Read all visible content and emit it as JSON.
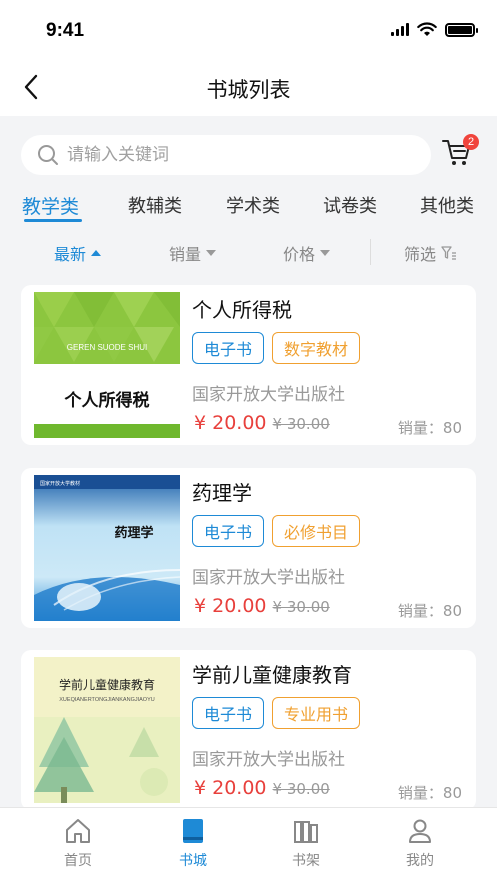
{
  "status_bar": {
    "time": "9:41"
  },
  "nav": {
    "title": "书城列表",
    "back_icon": "chevron-left-icon"
  },
  "search": {
    "placeholder": "请输入关键词",
    "cart_badge": "2"
  },
  "categories": [
    {
      "label": "教学类",
      "active": true
    },
    {
      "label": "教辅类",
      "active": false
    },
    {
      "label": "学术类",
      "active": false
    },
    {
      "label": "试卷类",
      "active": false
    },
    {
      "label": "其他类",
      "active": false
    }
  ],
  "sort": {
    "newest": "最新",
    "sales": "销量",
    "price": "价格",
    "filter": "筛选"
  },
  "books": [
    {
      "title": "个人所得税",
      "tags": [
        "电子书",
        "数字教材"
      ],
      "publisher": "国家开放大学出版社",
      "price": "¥ 20.00",
      "original_price": "¥ 30.00",
      "sales": "销量：80",
      "cover_text": "个人所得税",
      "cover_subtext": "GEREN SUODE SHUI"
    },
    {
      "title": "药理学",
      "tags": [
        "电子书",
        "必修书目"
      ],
      "publisher": "国家开放大学出版社",
      "price": "¥ 20.00",
      "original_price": "¥ 30.00",
      "sales": "销量：80",
      "cover_text": "药理学",
      "cover_subtext": "国家开放大学教材"
    },
    {
      "title": "学前儿童健康教育",
      "tags": [
        "电子书",
        "专业用书"
      ],
      "publisher": "国家开放大学出版社",
      "price": "¥ 20.00",
      "original_price": "¥ 30.00",
      "sales": "销量：80",
      "cover_text": "学前儿童健康教育",
      "cover_subtext": "XUEQIANERTONGJIANKANGJIAOYU"
    }
  ],
  "tab_bar": [
    {
      "label": "首页",
      "icon": "home-icon",
      "active": false
    },
    {
      "label": "书城",
      "icon": "book-icon",
      "active": true
    },
    {
      "label": "书架",
      "icon": "bookshelf-icon",
      "active": false
    },
    {
      "label": "我的",
      "icon": "user-icon",
      "active": false
    }
  ],
  "colors": {
    "accent": "#1e8ad6",
    "price": "#e8403c",
    "tag_orange": "#f0a030",
    "badge": "#f0443c"
  }
}
